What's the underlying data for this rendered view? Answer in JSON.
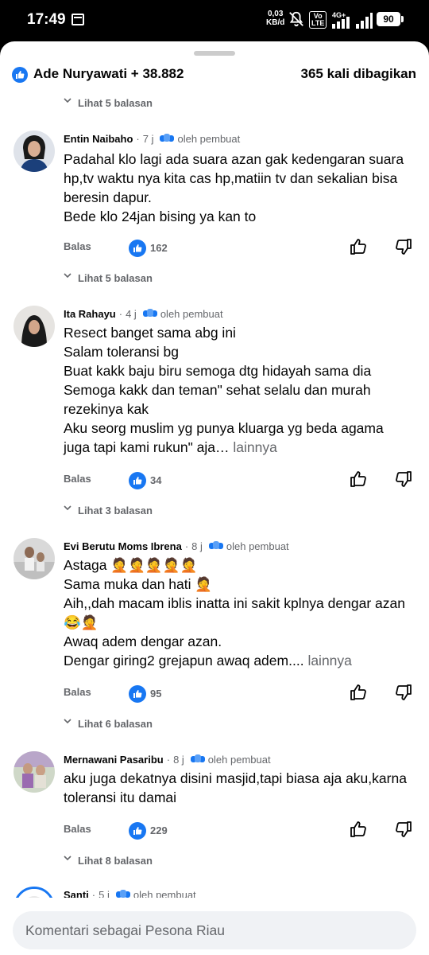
{
  "status_bar": {
    "time": "17:49",
    "network_speed_value": "0,03",
    "network_speed_unit": "KB/d",
    "volte_label": "Vo\nLTE",
    "signal_label": "4G+",
    "battery": "90"
  },
  "header": {
    "reactions_text": "Ade Nuryawati + 38.882",
    "shares_text": "365 kali dibagikan"
  },
  "comments": [
    {
      "replies_label": "Lihat 5 balasan",
      "name": "Entin Naibaho",
      "time": "7 j",
      "author_badge": "oleh pembuat",
      "text": "Padahal klo lagi ada suara azan gak kedengaran suara hp,tv  waktu nya kita cas hp,matiin tv dan sekalian bisa beresin dapur.\nBede klo 24jan bising ya kan to",
      "more": "",
      "reply_label": "Balas",
      "likes": "162",
      "replies_after": "Lihat 5 balasan"
    },
    {
      "name": "Ita Rahayu",
      "time": "4 j",
      "author_badge": "oleh pembuat",
      "text": "Resect banget sama abg ini\nSalam toleransi bg\nBuat kakk baju biru semoga dtg hidayah sama dia\nSemoga kakk dan teman\" sehat selalu dan murah rezekinya kak\nAku seorg muslim yg punya kluarga yg beda agama juga tapi kami rukun\" aja…",
      "more": "lainnya",
      "reply_label": "Balas",
      "likes": "34",
      "replies_after": "Lihat 3 balasan"
    },
    {
      "name": "Evi Berutu Moms Ibrena",
      "time": "8 j",
      "author_badge": "oleh pembuat",
      "text": "Astaga 🤦🤦🤦🤦🤦\nSama muka dan hati 🤦\nAih,,dah macam iblis inatta ini sakit kplnya dengar azan 😂🤦\nAwaq adem dengar azan.\nDengar giring2 grejapun awaq adem....",
      "more": "lainnya",
      "reply_label": "Balas",
      "likes": "95",
      "replies_after": "Lihat 6 balasan"
    },
    {
      "name": "Mernawani Pasaribu",
      "time": "8 j",
      "author_badge": "oleh pembuat",
      "text": "aku juga dekatnya disini masjid,tapi biasa aja aku,karna toleransi itu damai",
      "more": "",
      "reply_label": "Balas",
      "likes": "229",
      "replies_after": "Lihat 8 balasan"
    },
    {
      "name": "Santi",
      "time": "5 j",
      "author_badge": "oleh pembuat"
    }
  ],
  "composer": {
    "placeholder": "Komentari sebagai Pesona Riau"
  },
  "colors": {
    "brand_blue": "#1877f2",
    "secondary_text": "#65676b",
    "input_bg": "#f0f2f5"
  },
  "icons": [
    "calendar-icon",
    "mute-icon",
    "signal-icon",
    "like-icon",
    "thumb-up-icon",
    "thumb-down-icon",
    "chevron-down-icon",
    "author-badge-icon"
  ]
}
